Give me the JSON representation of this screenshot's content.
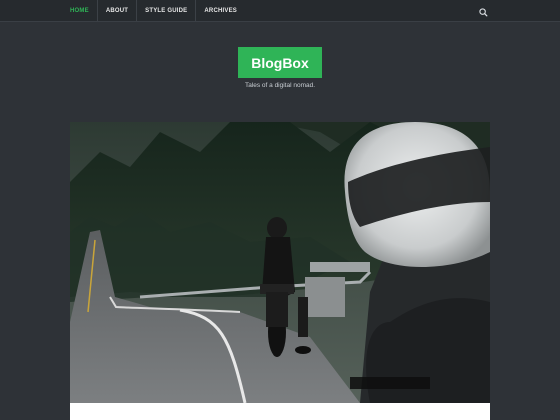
{
  "nav": {
    "items": [
      {
        "label": "HOME",
        "active": true
      },
      {
        "label": "ABOUT"
      },
      {
        "label": "STYLE GUIDE"
      },
      {
        "label": "ARCHIVES"
      }
    ],
    "search_icon": "search-icon"
  },
  "site": {
    "title": "BlogBox",
    "tagline": "Tales of a digital nomad."
  },
  "hero": {
    "image_alt": "",
    "icon": "featured-photo"
  },
  "colors": {
    "accent": "#2fb457",
    "background": "#2e3237",
    "nav_background": "#262a2e"
  }
}
